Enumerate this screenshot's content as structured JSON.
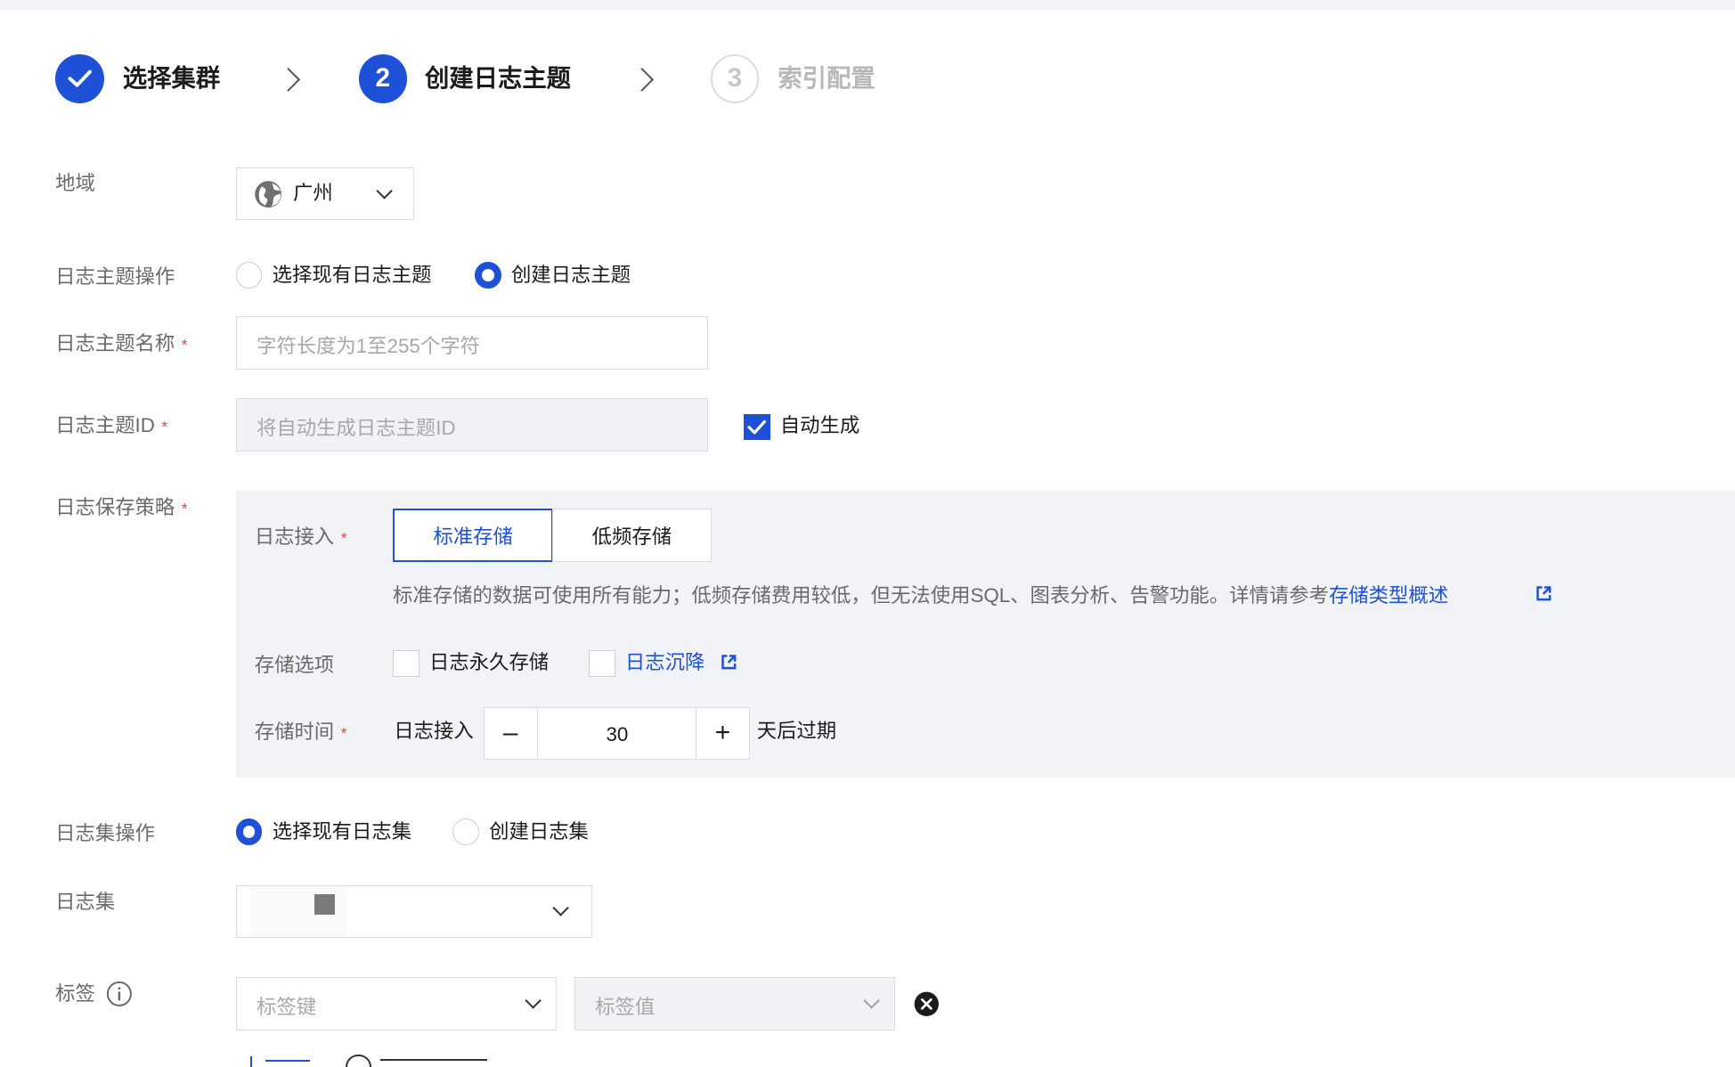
{
  "steps": [
    {
      "label": "选择集群",
      "state": "done"
    },
    {
      "number": "2",
      "label": "创建日志主题",
      "state": "active"
    },
    {
      "number": "3",
      "label": "索引配置",
      "state": "todo"
    }
  ],
  "region": {
    "label": "地域",
    "value": "广州",
    "icon": "globe-icon"
  },
  "topic_op": {
    "label": "日志主题操作",
    "options": [
      {
        "label": "选择现有日志主题",
        "selected": false
      },
      {
        "label": "创建日志主题",
        "selected": true
      }
    ]
  },
  "topic_name": {
    "label": "日志主题名称",
    "placeholder": "字符长度为1至255个字符"
  },
  "topic_id": {
    "label": "日志主题ID",
    "placeholder": "将自动生成日志主题ID",
    "auto_label": "自动生成",
    "auto_checked": true
  },
  "policy": {
    "label": "日志保存策略",
    "ingest_label": "日志接入",
    "tabs": [
      {
        "label": "标准存储",
        "selected": true
      },
      {
        "label": "低频存储",
        "selected": false
      }
    ],
    "hint_text": "标准存储的数据可使用所有能力；低频存储费用较低，但无法使用SQL、图表分析、告警功能。详情请参考",
    "hint_link": "存储类型概述",
    "options_label": "存储选项",
    "permanent_label": "日志永久存储",
    "sink_label": "日志沉降",
    "time_label": "存储时间",
    "time_prefix": "日志接入",
    "days": "30",
    "time_suffix": "天后过期",
    "minus": "–",
    "plus": "+"
  },
  "logset_op": {
    "label": "日志集操作",
    "options": [
      {
        "label": "选择现有日志集",
        "selected": true
      },
      {
        "label": "创建日志集",
        "selected": false
      }
    ]
  },
  "logset": {
    "label": "日志集"
  },
  "tags": {
    "label": "标签",
    "key_placeholder": "标签键",
    "value_placeholder": "标签值"
  },
  "colors": {
    "primary": "#1f50d8",
    "required": "#e54545"
  }
}
